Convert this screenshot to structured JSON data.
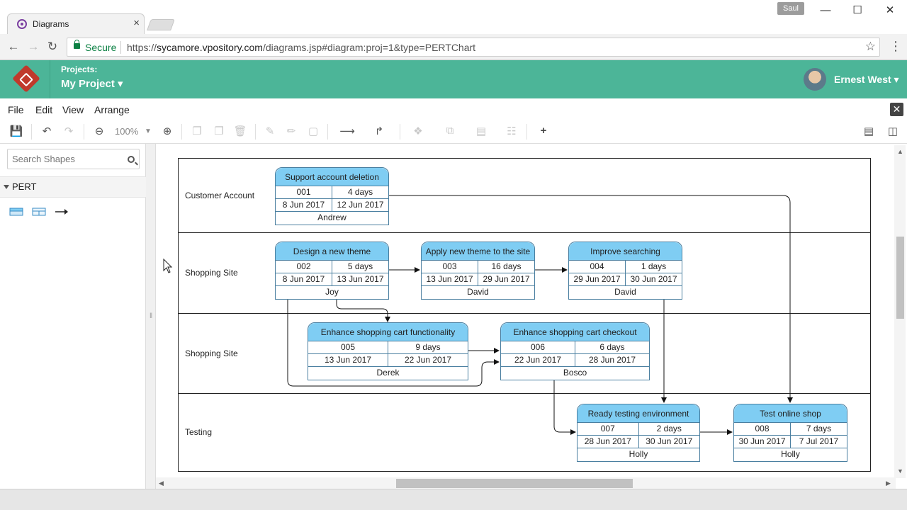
{
  "browser": {
    "tab_title": "Diagrams",
    "tab_close": "×",
    "profile": "Saul",
    "secure_label": "Secure",
    "url_scheme": "https://",
    "url_host": "sycamore.vpository.com",
    "url_path": "/diagrams.jsp#diagram:proj=1&type=PERTChart"
  },
  "app": {
    "projects_label": "Projects:",
    "project_name": "My Project ▾",
    "user_name": "Ernest West ▾"
  },
  "menu": {
    "file": "File",
    "edit": "Edit",
    "view": "View",
    "arrange": "Arrange"
  },
  "toolbar": {
    "zoom": "100%"
  },
  "sidebar": {
    "search_placeholder": "Search Shapes",
    "category": "PERT"
  },
  "diagram": {
    "lanes": [
      {
        "label": "Customer Account"
      },
      {
        "label": "Shopping Site"
      },
      {
        "label": "Shopping Site"
      },
      {
        "label": "Testing"
      }
    ],
    "tasks": [
      {
        "name": "Support account deletion",
        "id": "001",
        "duration": "4 days",
        "start": "8 Jun 2017",
        "end": "12 Jun 2017",
        "owner": "Andrew"
      },
      {
        "name": "Design a new theme",
        "id": "002",
        "duration": "5 days",
        "start": "8 Jun 2017",
        "end": "13 Jun 2017",
        "owner": "Joy"
      },
      {
        "name": "Apply new theme to the site",
        "id": "003",
        "duration": "16 days",
        "start": "13 Jun 2017",
        "end": "29 Jun 2017",
        "owner": "David"
      },
      {
        "name": "Improve searching",
        "id": "004",
        "duration": "1 days",
        "start": "29 Jun 2017",
        "end": "30 Jun 2017",
        "owner": "David"
      },
      {
        "name": "Enhance shopping cart functionality",
        "id": "005",
        "duration": "9 days",
        "start": "13 Jun 2017",
        "end": "22 Jun 2017",
        "owner": "Derek"
      },
      {
        "name": "Enhance shopping cart checkout",
        "id": "006",
        "duration": "6 days",
        "start": "22 Jun 2017",
        "end": "28 Jun 2017",
        "owner": "Bosco"
      },
      {
        "name": "Ready testing environment",
        "id": "007",
        "duration": "2 days",
        "start": "28 Jun 2017",
        "end": "30 Jun 2017",
        "owner": "Holly"
      },
      {
        "name": "Test online shop",
        "id": "008",
        "duration": "7 days",
        "start": "30 Jun 2017",
        "end": "7 Jul 2017",
        "owner": "Holly"
      }
    ]
  }
}
